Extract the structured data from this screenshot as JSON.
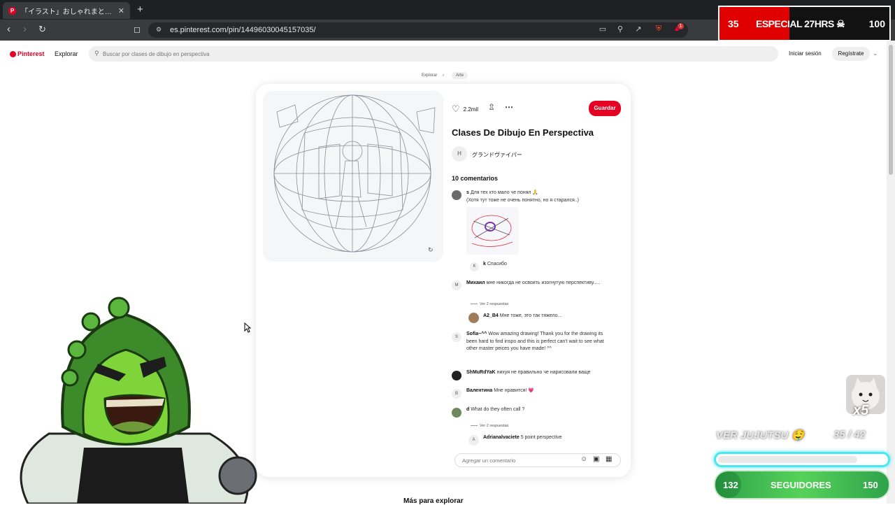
{
  "browser": {
    "tab_favicon": "P",
    "tab_title": "「イラスト」おしゃれまとめの人気アイデ",
    "tab_close": "✕",
    "new_tab": "+",
    "url": "es.pinterest.com/pin/14496030045157035/",
    "extension_badge": "1"
  },
  "stream_top": {
    "left_count": "35",
    "title": "ESPECIAL 27HRS ☠",
    "right_count": "100",
    "accent": "#e00000"
  },
  "header": {
    "logo": "Pinterest",
    "explore": "Explorar",
    "search_placeholder": "Buscar por clases de dibujo en perspectiva",
    "login": "Iniciar sesión",
    "register": "Regístrate"
  },
  "breadcrumb": {
    "items": [
      "Explorar",
      "Arte"
    ],
    "separator": "›"
  },
  "pin": {
    "likes": "2.2mil",
    "save": "Guardar",
    "title": "Clases De Dibujo En Perspectiva",
    "author_initial": "H",
    "author": "グランドヴァイパー",
    "comments_count": "10 comentarios",
    "brand_color": "#e60023"
  },
  "comments": [
    {
      "initial": "",
      "user": "s",
      "text": "Для тех кто мало че понял 🙏",
      "text2": "(Хотя тут тоже не очень понятно, но я старался..)"
    },
    {
      "initial": "K",
      "user": "k",
      "text": "Спасибо"
    },
    {
      "initial": "М",
      "user": "Михаил",
      "text": "мне никогда не освоить изогнутую перспективу....."
    },
    {
      "replies": "Ver 2 respuestas"
    },
    {
      "initial": "",
      "user": "A2_B4",
      "text": "Мне тоже, это так тяжело..."
    },
    {
      "initial": "S",
      "user": "Sofia~^^",
      "text": "Wow amazing drawing! Thank you for the drawing its been hard to find inspo and this is perfect can't wait to see what other master peices you have made! ^^"
    },
    {
      "initial": "",
      "user": "ShMuRdYaK",
      "text": "нихуя не правильно че нарисовали ваще"
    },
    {
      "initial": "В",
      "user": "Валентина",
      "text": "Мне нравится! 💗"
    },
    {
      "initial": "",
      "user": "d",
      "text": "What do they often call ?"
    },
    {
      "replies": "Ver 2 respuestas"
    },
    {
      "initial": "A",
      "user": "Adrianalvaciete",
      "text": "5 point perspective"
    }
  ],
  "add_comment_placeholder": "Agregar un comentario",
  "more_to_explore": "Más para explorar",
  "stream_bottom": {
    "multiplier": "x5",
    "goal_label": "VER JUJUTSU 🤤",
    "goal_count": "35 / 42",
    "goal_fraction": 0.83,
    "followers_left": "132",
    "followers_label": "SEGUIDORES",
    "followers_right": "150",
    "followers_fraction": 0.15
  }
}
